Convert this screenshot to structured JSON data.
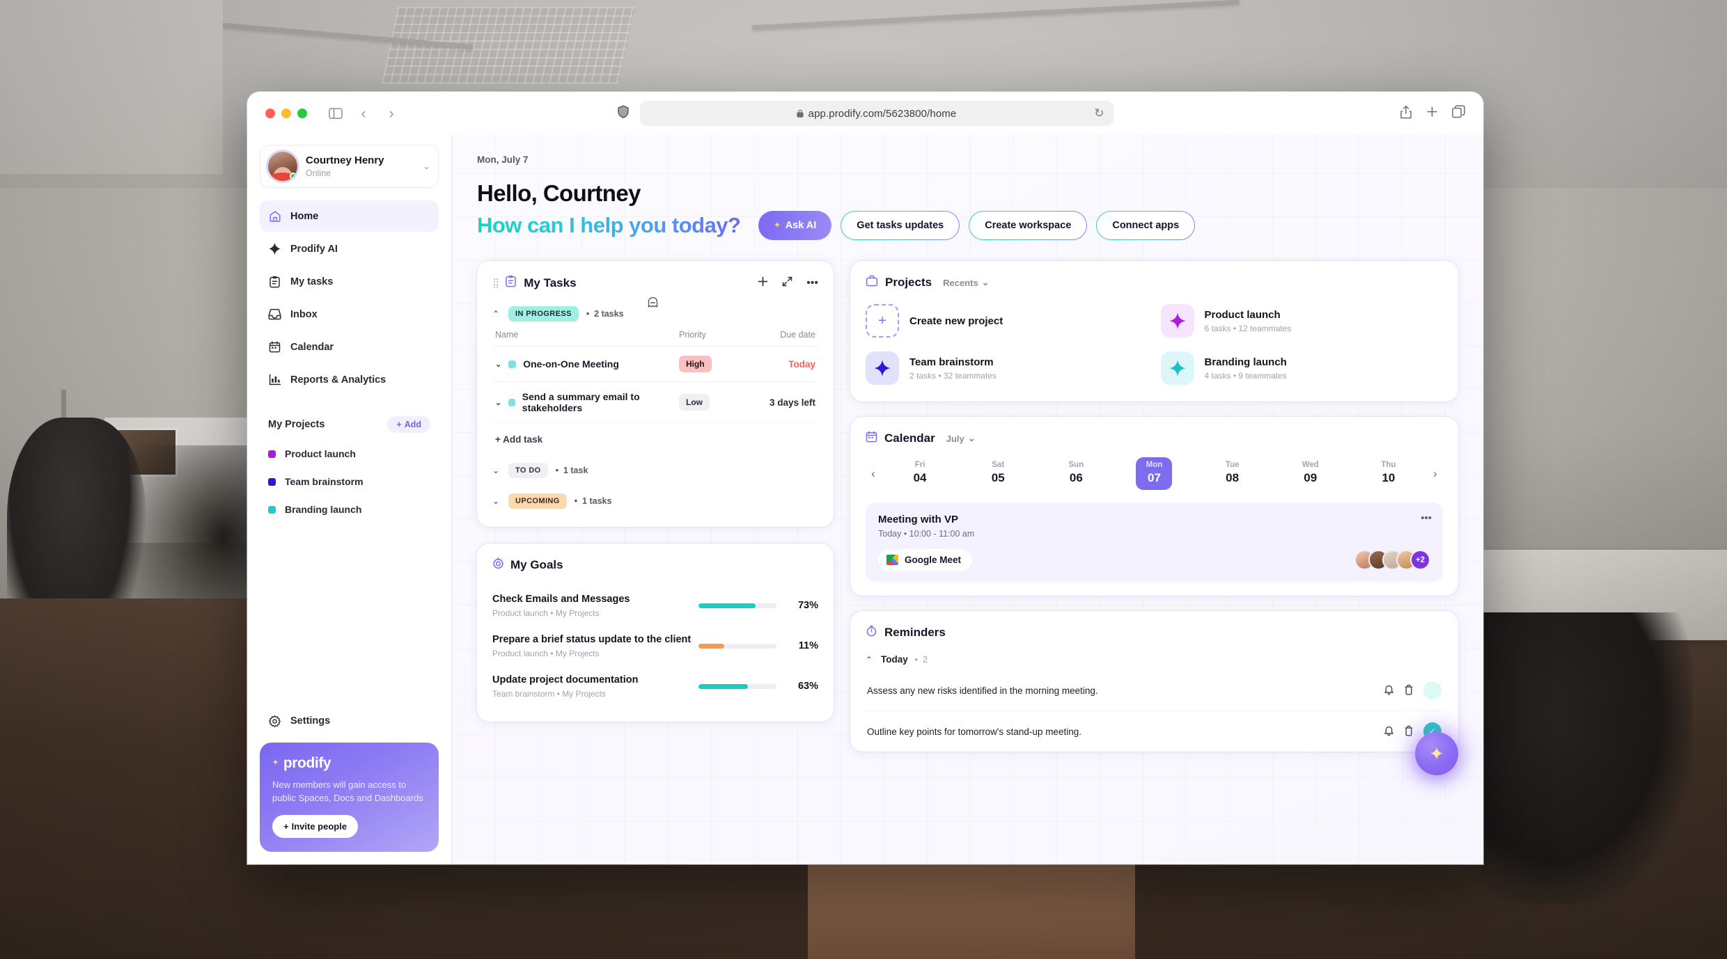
{
  "browser": {
    "url": "app.prodify.com/5623800/home",
    "lock_icon": "lock-icon",
    "shield_icon": "shield-icon",
    "reload_icon": "reload-icon",
    "back_icon": "chevron-left-icon",
    "forward_icon": "chevron-right-icon",
    "sidebar_icon": "sidebar-toggle-icon",
    "share_icon": "share-icon",
    "new_tab_icon": "plus-icon",
    "tabs_icon": "tab-overview-icon"
  },
  "sidebar": {
    "user": {
      "name": "Courtney Henry",
      "status": "Online",
      "chevron": "⌄"
    },
    "nav": [
      {
        "label": "Home",
        "icon": "home-icon",
        "active": true
      },
      {
        "label": "Prodify AI",
        "icon": "sparkle-icon",
        "active": false
      },
      {
        "label": "My tasks",
        "icon": "clipboard-icon",
        "active": false
      },
      {
        "label": "Inbox",
        "icon": "inbox-icon",
        "active": false
      },
      {
        "label": "Calendar",
        "icon": "calendar-icon",
        "active": false
      },
      {
        "label": "Reports & Analytics",
        "icon": "bar-chart-icon",
        "active": false
      }
    ],
    "projects_title": "My Projects",
    "add_label": "Add",
    "projects": [
      {
        "label": "Product launch",
        "color": "#aa1fd4"
      },
      {
        "label": "Team brainstorm",
        "color": "#2a18d9"
      },
      {
        "label": "Branding launch",
        "color": "#25c8cf"
      }
    ],
    "settings_label": "Settings",
    "promo": {
      "brand": "prodify",
      "text": "New members will gain access to public Spaces, Docs and Dashboards",
      "button": "Invite people"
    }
  },
  "header": {
    "date": "Mon, July 7",
    "greeting": "Hello, Courtney",
    "subgreeting": "How can I help you today?",
    "ctas": [
      {
        "label": "Ask AI",
        "primary": true
      },
      {
        "label": "Get tasks updates",
        "primary": false
      },
      {
        "label": "Create workspace",
        "primary": false
      },
      {
        "label": "Connect apps",
        "primary": false
      }
    ]
  },
  "tasks_card": {
    "title": "My Tasks",
    "columns": {
      "name": "Name",
      "priority": "Priority",
      "due": "Due date"
    },
    "groups": [
      {
        "chip": "IN PROGRESS",
        "count": "2 tasks",
        "style": "progress",
        "expanded": true
      },
      {
        "chip": "TO DO",
        "count": "1 task",
        "style": "todo",
        "expanded": false
      },
      {
        "chip": "UPCOMING",
        "count": "1 tasks",
        "style": "upcoming",
        "expanded": false
      }
    ],
    "rows": [
      {
        "name": "One-on-One Meeting",
        "priority": "High",
        "priority_style": "high",
        "due": "Today",
        "due_style": "today"
      },
      {
        "name": "Send a summary email to stakeholders",
        "priority": "Low",
        "priority_style": "low",
        "due": "3 days left",
        "due_style": "normal"
      }
    ],
    "add_task": "+ Add task"
  },
  "goals_card": {
    "title": "My Goals",
    "goals": [
      {
        "name": "Check Emails and Messages",
        "meta": "Product launch  •  My Projects",
        "percent": "73%",
        "value": 73,
        "color": "#17cfbe"
      },
      {
        "name": "Prepare a brief status update to the client",
        "meta": "Product launch  •  My Projects",
        "percent": "11%",
        "value": 11,
        "color": "#f79b4b"
      },
      {
        "name": "Update project documentation",
        "meta": "Team brainstorm  •  My Projects",
        "percent": "63%",
        "value": 63,
        "color": "#17cfbe"
      }
    ]
  },
  "projects_card": {
    "title": "Projects",
    "filter": "Recents",
    "create_label": "Create new project",
    "items": [
      {
        "name": "Product launch",
        "meta": "6 tasks  •  12 teammates",
        "color": "#aa1fd4",
        "bg": "#f6e4fd"
      },
      {
        "name": "Team brainstorm",
        "meta": "2 tasks  •  32 teammates",
        "color": "#2a18d9",
        "bg": "#e3e2fd"
      },
      {
        "name": "Branding launch",
        "meta": "4 tasks  •  9 teammates",
        "color": "#1fbfcc",
        "bg": "#ddf6fa"
      }
    ]
  },
  "calendar_card": {
    "title": "Calendar",
    "month": "July",
    "days": [
      {
        "dow": "Fri",
        "num": "04",
        "selected": false
      },
      {
        "dow": "Sat",
        "num": "05",
        "selected": false
      },
      {
        "dow": "Sun",
        "num": "06",
        "selected": false
      },
      {
        "dow": "Mon",
        "num": "07",
        "selected": true
      },
      {
        "dow": "Tue",
        "num": "08",
        "selected": false
      },
      {
        "dow": "Wed",
        "num": "09",
        "selected": false
      },
      {
        "dow": "Thu",
        "num": "10",
        "selected": false
      }
    ],
    "event": {
      "title": "Meeting with VP",
      "time": "Today  •  10:00 - 11:00 am",
      "meet_label": "Google Meet",
      "extra_avatars": "+2"
    }
  },
  "reminders_card": {
    "title": "Reminders",
    "group_label": "Today",
    "group_count": "2",
    "items": [
      {
        "text": "Assess any new risks identified in the morning meeting.",
        "done": false
      },
      {
        "text": "Outline key points for tomorrow's stand-up meeting.",
        "done": true
      }
    ]
  },
  "fab": {
    "icon": "sparkle-icon"
  },
  "colors": {
    "accent": "#7d6cf2",
    "teal": "#17cfbe",
    "danger": "#fb5d5d",
    "orange": "#f79b4b"
  }
}
